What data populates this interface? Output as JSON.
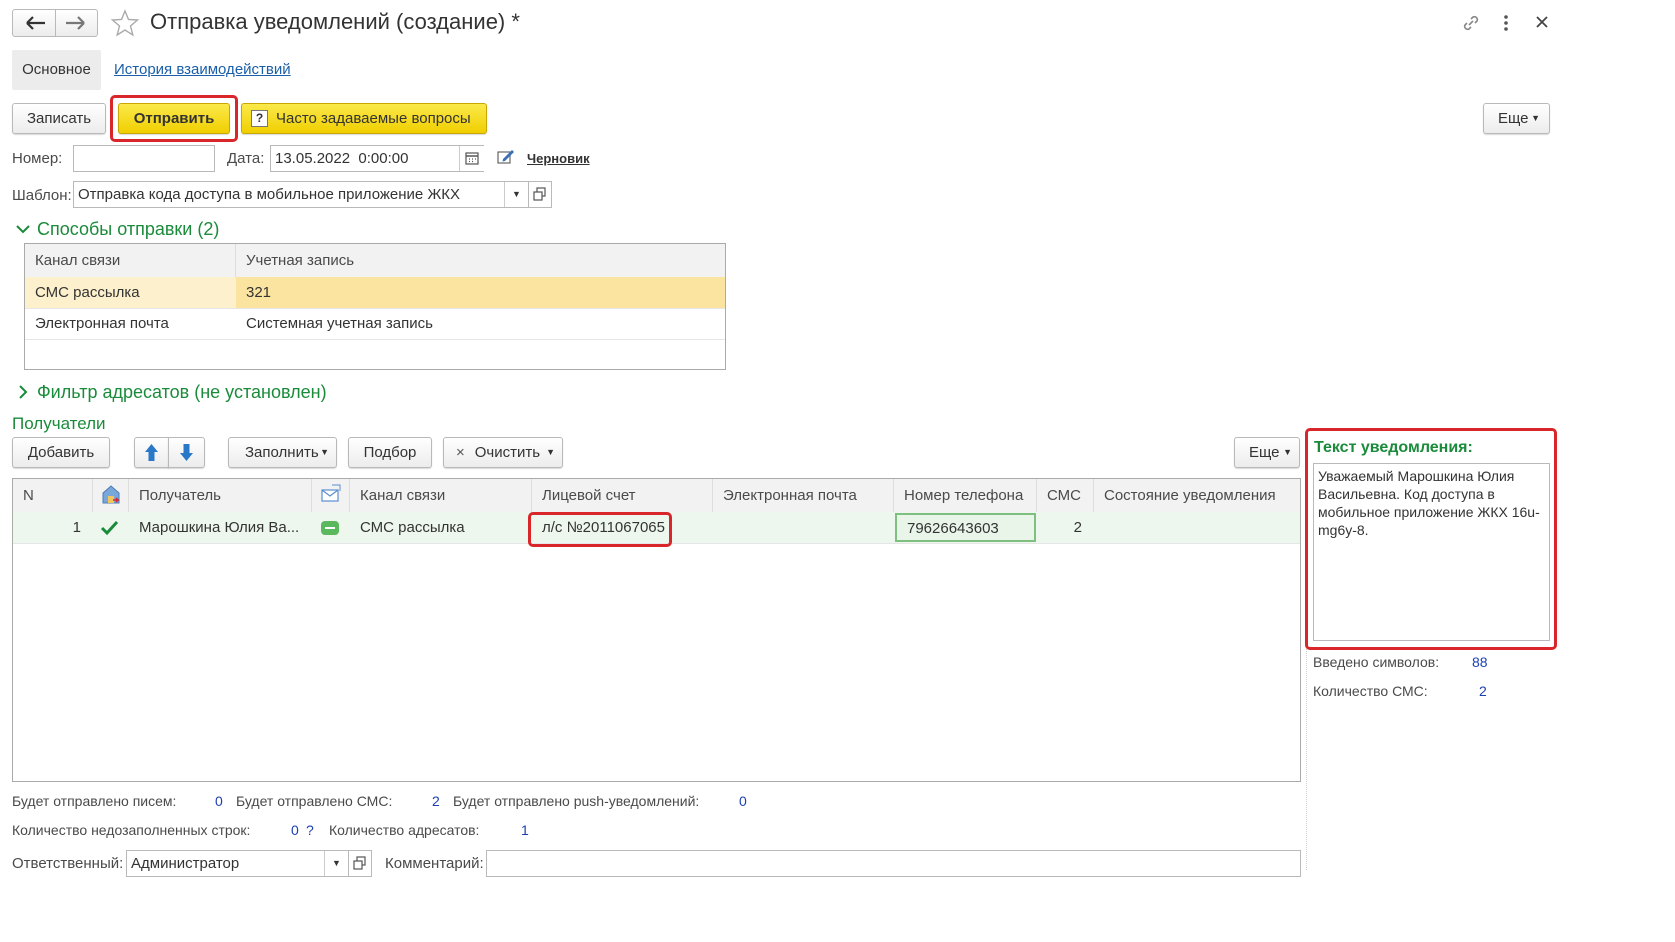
{
  "window": {
    "title": "Отправка уведомлений (создание) *"
  },
  "tabs": [
    {
      "label": "Основное"
    },
    {
      "label": "История взаимодействий"
    }
  ],
  "toolbar": {
    "save_label": "Записать",
    "send_label": "Отправить",
    "faq_label": "Часто задаваемые вопросы",
    "more_label": "Еще"
  },
  "form": {
    "number_label": "Номер:",
    "number_value": "",
    "date_label": "Дата:",
    "date_value": "13.05.2022  0:00:00",
    "status_link": "Черновик",
    "template_label": "Шаблон:",
    "template_value": "Отправка кода доступа в мобильное приложение ЖКХ"
  },
  "send_methods": {
    "title": "Способы отправки (2)",
    "columns": [
      "Канал связи",
      "Учетная запись"
    ],
    "rows": [
      {
        "channel": "СМС рассылка",
        "account": "321"
      },
      {
        "channel": "Электронная почта",
        "account": "Системная учетная запись"
      }
    ]
  },
  "filter": {
    "title": "Фильтр адресатов (не установлен)"
  },
  "recipients": {
    "title": "Получатели",
    "add_label": "Добавить",
    "fill_label": "Заполнить",
    "pick_label": "Подбор",
    "clear_label": "Очистить",
    "more_label": "Еще",
    "columns": {
      "n": "N",
      "recipient": "Получатель",
      "channel": "Канал связи",
      "account": "Лицевой счет",
      "email": "Электронная почта",
      "phone": "Номер телефона",
      "sms": "СМС",
      "state": "Состояние уведомления"
    },
    "rows": [
      {
        "n": "1",
        "recipient": "Марошкина Юлия Ва...",
        "channel": "СМС рассылка",
        "account": "л/с №2011067065",
        "email": "",
        "phone": "79626643603",
        "sms": "2",
        "state": ""
      }
    ]
  },
  "notification": {
    "title": "Текст уведомления:",
    "text": "Уважаемый Марошкина Юлия Васильевна. Код доступа в мобильное приложение ЖКХ 16u-mg6y-8.",
    "chars_label": "Введено символов:",
    "chars_value": "88",
    "sms_count_label": "Количество СМС:",
    "sms_count_value": "2"
  },
  "summary": {
    "letters_label": "Будет отправлено писем:",
    "letters_value": "0",
    "sms_label": "Будет отправлено СМС:",
    "sms_value": "2",
    "push_label": "Будет отправлено push-уведомлений:",
    "push_value": "0",
    "incomplete_label": "Количество недозаполненных строк:",
    "incomplete_value": "0",
    "incomplete_hint": "?",
    "addressees_label": "Количество адресатов:",
    "addressees_value": "1"
  },
  "footer": {
    "responsible_label": "Ответственный:",
    "responsible_value": "Администратор",
    "comment_label": "Комментарий:",
    "comment_value": ""
  },
  "colors": {
    "accent_green": "#1a8b3a",
    "highlight_red": "#d9262b",
    "selected_row": "#fbe3a0",
    "link_blue": "#1a5fa8"
  }
}
